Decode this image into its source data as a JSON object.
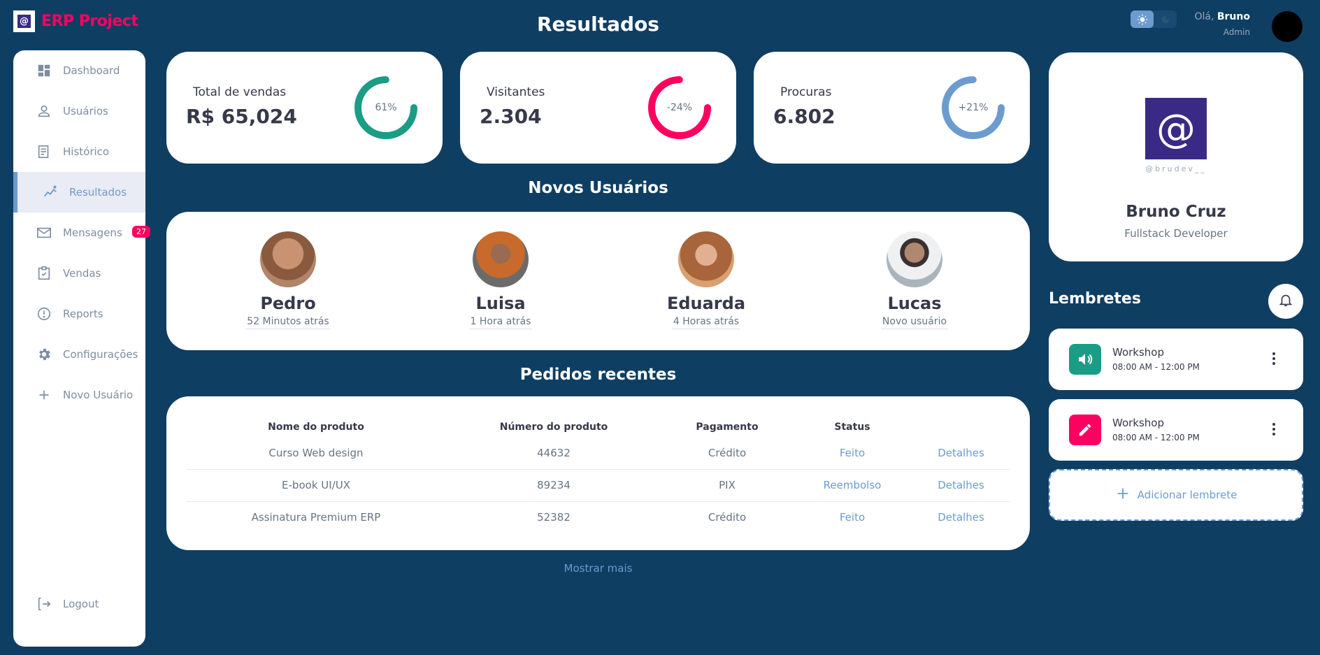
{
  "app": {
    "logo_glyph": "@",
    "title": "ERP Project"
  },
  "page_title": "Resultados",
  "sidebar": {
    "items": [
      {
        "label": "Dashboard",
        "icon": "dashboard-icon"
      },
      {
        "label": "Usuários",
        "icon": "person-icon"
      },
      {
        "label": "Histórico",
        "icon": "receipt-icon"
      },
      {
        "label": "Resultados",
        "icon": "insights-icon",
        "active": true
      },
      {
        "label": "Mensagens",
        "icon": "mail-icon",
        "badge": "27"
      },
      {
        "label": "Vendas",
        "icon": "inventory-icon"
      },
      {
        "label": "Reports",
        "icon": "report-icon"
      },
      {
        "label": "Configurações",
        "icon": "settings-icon"
      },
      {
        "label": "Novo Usuário",
        "icon": "add-icon"
      }
    ],
    "logout": {
      "label": "Logout",
      "icon": "logout-icon"
    }
  },
  "header": {
    "greeting_prefix": "Olá,",
    "user_name": "Bruno",
    "role": "Admin",
    "theme_toggle": {
      "light_icon": "sun-icon",
      "dark_icon": "moon-icon",
      "active": "light"
    }
  },
  "stats": [
    {
      "label": "Total de vendas",
      "value": "R$ 65,024",
      "percent_text": "61%",
      "color": "#1b9c85"
    },
    {
      "label": "Visitantes",
      "value": "2.304",
      "percent_text": "-24%",
      "color": "#ff0060"
    },
    {
      "label": "Procuras",
      "value": "6.802",
      "percent_text": "+21%",
      "color": "#6c9bcf"
    }
  ],
  "new_users": {
    "title": "Novos Usuários",
    "users": [
      {
        "name": "Pedro",
        "time": "52 Minutos atrás"
      },
      {
        "name": "Luisa",
        "time": "1 Hora atrás"
      },
      {
        "name": "Eduarda",
        "time": "4 Horas atrás"
      },
      {
        "name": "Lucas",
        "time": "Novo usuário"
      }
    ]
  },
  "orders": {
    "title": "Pedidos recentes",
    "columns": [
      "Nome do produto",
      "Número do produto",
      "Pagamento",
      "Status",
      ""
    ],
    "rows": [
      {
        "product": "Curso Web design",
        "number": "44632",
        "payment": "Crédito",
        "status": "Feito",
        "details": "Detalhes"
      },
      {
        "product": "E-book UI/UX",
        "number": "89234",
        "payment": "PIX",
        "status": "Reembolso",
        "details": "Detalhes"
      },
      {
        "product": "Assinatura Premium ERP",
        "number": "52382",
        "payment": "Crédito",
        "status": "Feito",
        "details": "Detalhes"
      }
    ],
    "show_more": "Mostrar mais"
  },
  "profile": {
    "logo_glyph": "@",
    "handle": "@brudev__",
    "name": "Bruno Cruz",
    "role": "Fullstack Developer"
  },
  "reminders": {
    "title": "Lembretes",
    "items": [
      {
        "title": "Workshop",
        "time": "08:00 AM - 12:00 PM",
        "icon": "volume-icon",
        "color": "#1b9c85"
      },
      {
        "title": "Workshop",
        "time": "08:00 AM - 12:00 PM",
        "icon": "edit-icon",
        "color": "#ff0060"
      }
    ],
    "add_label": "Adicionar lembrete"
  }
}
